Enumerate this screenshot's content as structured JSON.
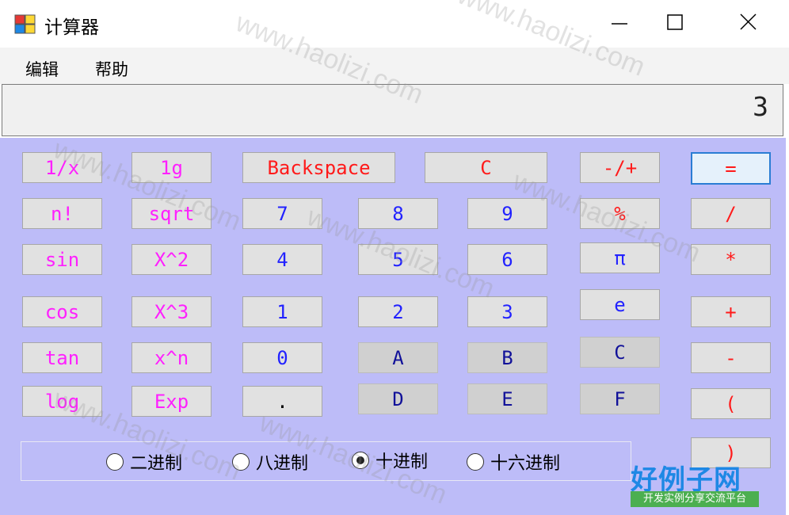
{
  "window": {
    "title": "计算器",
    "minimize_icon": "minimize-icon",
    "maximize_icon": "maximize-icon",
    "close_icon": "close-icon"
  },
  "menu": {
    "edit": "编辑",
    "help": "帮助"
  },
  "display": {
    "value": "3"
  },
  "buttons": {
    "reciprocal": "1/x",
    "lg": "1g",
    "backspace": "Backspace",
    "clear": "C",
    "negate": "-/+",
    "equals": "=",
    "factorial": "n!",
    "sqrt": "sqrt",
    "seven": "7",
    "eight": "8",
    "nine": "9",
    "percent": "%",
    "divide": "/",
    "sin": "sin",
    "square": "X^2",
    "four": "4",
    "five": "5",
    "six": "6",
    "pi": "π",
    "multiply": "*",
    "cos": "cos",
    "cube": "X^3",
    "one": "1",
    "two": "2",
    "three": "3",
    "e": "e",
    "plus": "+",
    "tan": "tan",
    "power": "x^n",
    "zero": "0",
    "hex_a": "A",
    "hex_b": "B",
    "hex_c": "C",
    "minus": "-",
    "log": "log",
    "exp": "Exp",
    "dot": ".",
    "hex_d": "D",
    "hex_e": "E",
    "hex_f": "F",
    "lparen": "(",
    "rparen": ")"
  },
  "base": {
    "options": [
      "二进制",
      "八进制",
      "十进制",
      "十六进制"
    ],
    "selected": "十进制"
  },
  "watermark": {
    "text": "www.haolizi.com",
    "brand": "好例子网",
    "brand_sub": "开发实例分享交流平台"
  }
}
